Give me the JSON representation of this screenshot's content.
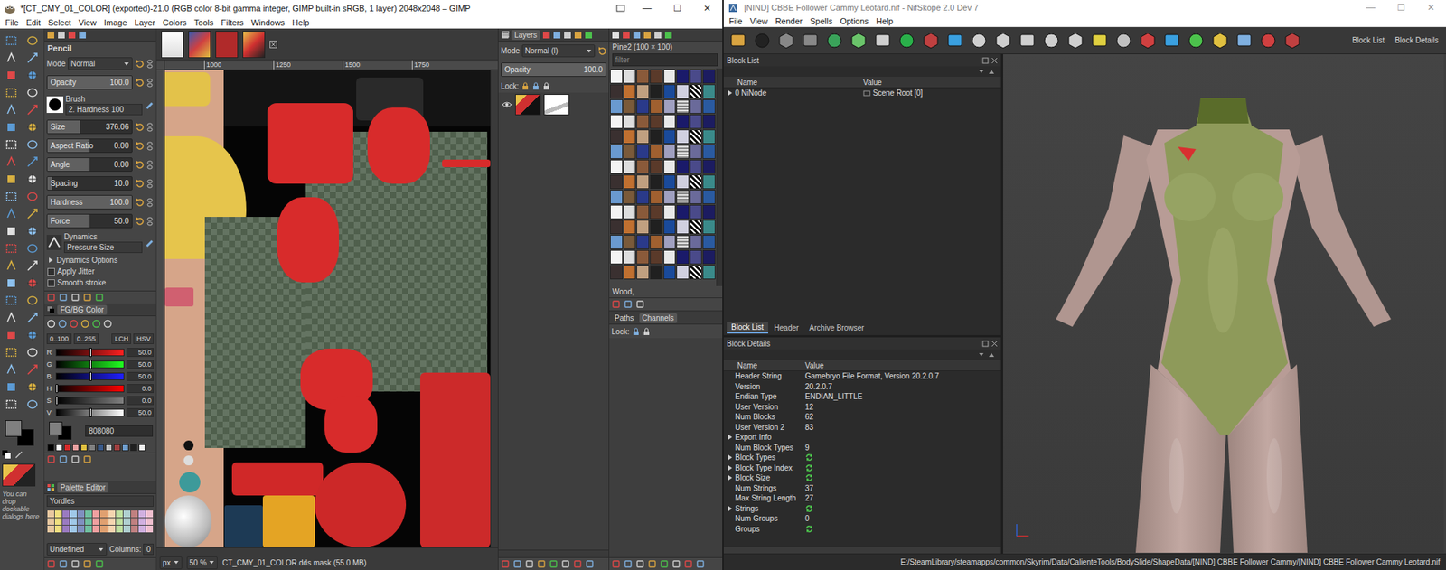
{
  "gimp": {
    "title": "*[CT_CMY_01_COLOR] (exported)-21.0 (RGB color 8-bit gamma integer, GIMP built-in sRGB, 1 layer) 2048x2048 – GIMP",
    "controls": [
      "—",
      "☐",
      "✕"
    ],
    "menu": [
      "File",
      "Edit",
      "Select",
      "View",
      "Image",
      "Layer",
      "Colors",
      "Tools",
      "Filters",
      "Windows",
      "Help"
    ],
    "toolbox_hint": "You can drop dockable dialogs here",
    "tool_options": {
      "title": "Pencil",
      "mode_label": "Mode",
      "mode_value": "Normal",
      "opacity": {
        "label": "Opacity",
        "value": "100.0",
        "level": 1
      },
      "brush_label": "Brush",
      "brush_value": "2. Hardness 100",
      "sliders": [
        {
          "label": "Size",
          "value": "376.06",
          "level": 0.38
        },
        {
          "label": "Aspect Ratio",
          "value": "0.00",
          "level": 0.5
        },
        {
          "label": "Angle",
          "value": "0.00",
          "level": 0.5
        },
        {
          "label": "Spacing",
          "value": "10.0",
          "level": 0.05
        },
        {
          "label": "Hardness",
          "value": "100.0",
          "level": 1
        },
        {
          "label": "Force",
          "value": "50.0",
          "level": 0.5
        }
      ],
      "dynamics_label": "Dynamics",
      "dynamics_value": "Pressure Size",
      "options": [
        {
          "label": "Dynamics Options",
          "kind": "expander",
          "expanded": false,
          "checked": false
        },
        {
          "label": "Apply Jitter",
          "kind": "checkbox",
          "expanded": false,
          "checked": false
        },
        {
          "label": "Smooth stroke",
          "kind": "checkbox",
          "expanded": false,
          "checked": false
        }
      ]
    },
    "fgbg": {
      "tab": "FG/BG Color",
      "ranges": [
        "0..100",
        "0..255"
      ],
      "models": [
        "LCH",
        "HSV"
      ],
      "sliders": [
        {
          "label": "R",
          "value": "50.0",
          "level": 0.5,
          "color": "#ff2020"
        },
        {
          "label": "G",
          "value": "50.0",
          "level": 0.5,
          "color": "#20ff20"
        },
        {
          "label": "B",
          "value": "50.0",
          "level": 0.5,
          "color": "#2020ff"
        },
        {
          "label": "H",
          "value": "0.0",
          "level": 0,
          "color": "#ff0000"
        },
        {
          "label": "S",
          "value": "0.0",
          "level": 0,
          "color": "#808080"
        },
        {
          "label": "V",
          "value": "50.0",
          "level": 0.5,
          "color": "#ffffff"
        }
      ],
      "hex": "808080",
      "fg_color": "#808080",
      "bg_color": "#000000"
    },
    "palette": {
      "tab": "Palette Editor",
      "name": "Yordles",
      "mode": "Undefined",
      "columns_label": "Columns:",
      "columns_value": "0"
    },
    "canvas": {
      "ruler": [
        "1000",
        "1250",
        "1500",
        "1750"
      ],
      "unit": "px",
      "zoom": "50 %",
      "status": "CT_CMY_01_COLOR.dds mask (55.0 MB)"
    },
    "layers": {
      "tab": "Layers",
      "mode_label": "Mode",
      "mode_value": "Normal (l)",
      "opacity_label": "Opacity",
      "opacity_value": "100.0",
      "opacity_level": 1,
      "lock_label": "Lock:",
      "items": [
        {
          "visible": true,
          "selected": false
        }
      ]
    },
    "patterns": {
      "current": "Pine2 (100 × 100)",
      "filter_placeholder": "filter",
      "selected_name": "Wood,"
    },
    "paths": {
      "tabs": [
        {
          "label": "Paths",
          "selected": false
        },
        {
          "label": "Channels",
          "selected": true
        }
      ],
      "lock_label": "Lock:"
    }
  },
  "nifskope": {
    "title": "[NIND] CBBE Follower Cammy Leotard.nif - NifSkope 2.0 Dev 7",
    "controls": [
      "—",
      "☐",
      "✕"
    ],
    "menu": [
      "File",
      "View",
      "Render",
      "Spells",
      "Options",
      "Help"
    ],
    "toolbar_buttons": [
      "Block List",
      "Block Details"
    ],
    "block_list": {
      "title": "Block List",
      "columns": [
        "Name",
        "Value"
      ],
      "rows": [
        {
          "name": "0 NiNode",
          "value": "Scene Root [0]",
          "expanded": false
        }
      ]
    },
    "tabs": [
      {
        "label": "Block List",
        "selected": true
      },
      {
        "label": "Header",
        "selected": false
      },
      {
        "label": "Archive Browser",
        "selected": false
      }
    ],
    "block_details": {
      "title": "Block Details",
      "columns": [
        "Name",
        "Value"
      ],
      "rows": [
        {
          "name": "Header String",
          "value": "Gamebryo File Format, Version 20.2.0.7",
          "kind": "text",
          "expandable": false,
          "expanded": false
        },
        {
          "name": "Version",
          "value": "20.2.0.7",
          "kind": "text",
          "expandable": false,
          "expanded": false
        },
        {
          "name": "Endian Type",
          "value": "ENDIAN_LITTLE",
          "kind": "text",
          "expandable": false,
          "expanded": false
        },
        {
          "name": "User Version",
          "value": "12",
          "kind": "text",
          "expandable": false,
          "expanded": false
        },
        {
          "name": "Num Blocks",
          "value": "62",
          "kind": "text",
          "expandable": false,
          "expanded": false
        },
        {
          "name": "User Version 2",
          "value": "83",
          "kind": "text",
          "expandable": false,
          "expanded": false
        },
        {
          "name": "Export Info",
          "kind": "empty",
          "expandable": true,
          "expanded": false
        },
        {
          "name": "Num Block Types",
          "value": "9",
          "kind": "text",
          "expandable": false,
          "expanded": false
        },
        {
          "name": "Block Types",
          "kind": "icon",
          "expandable": true,
          "expanded": false
        },
        {
          "name": "Block Type Index",
          "kind": "icon",
          "expandable": true,
          "expanded": false
        },
        {
          "name": "Block Size",
          "kind": "icon",
          "expandable": true,
          "expanded": false
        },
        {
          "name": "Num Strings",
          "value": "37",
          "kind": "text",
          "expandable": false,
          "expanded": false
        },
        {
          "name": "Max String Length",
          "value": "27",
          "kind": "text",
          "expandable": false,
          "expanded": false
        },
        {
          "name": "Strings",
          "kind": "icon",
          "expandable": true,
          "expanded": false
        },
        {
          "name": "Num Groups",
          "value": "0",
          "kind": "text",
          "expandable": false,
          "expanded": false
        },
        {
          "name": "Groups",
          "kind": "icon",
          "expandable": false,
          "expanded": false
        }
      ]
    },
    "status": "E:/SteamLibrary/steamapps/common/Skyrim/Data/CalienteTools/BodySlide/ShapeData/[NIND] CBBE Follower Cammy/[NIND] CBBE Follower Cammy Leotard.nif"
  }
}
